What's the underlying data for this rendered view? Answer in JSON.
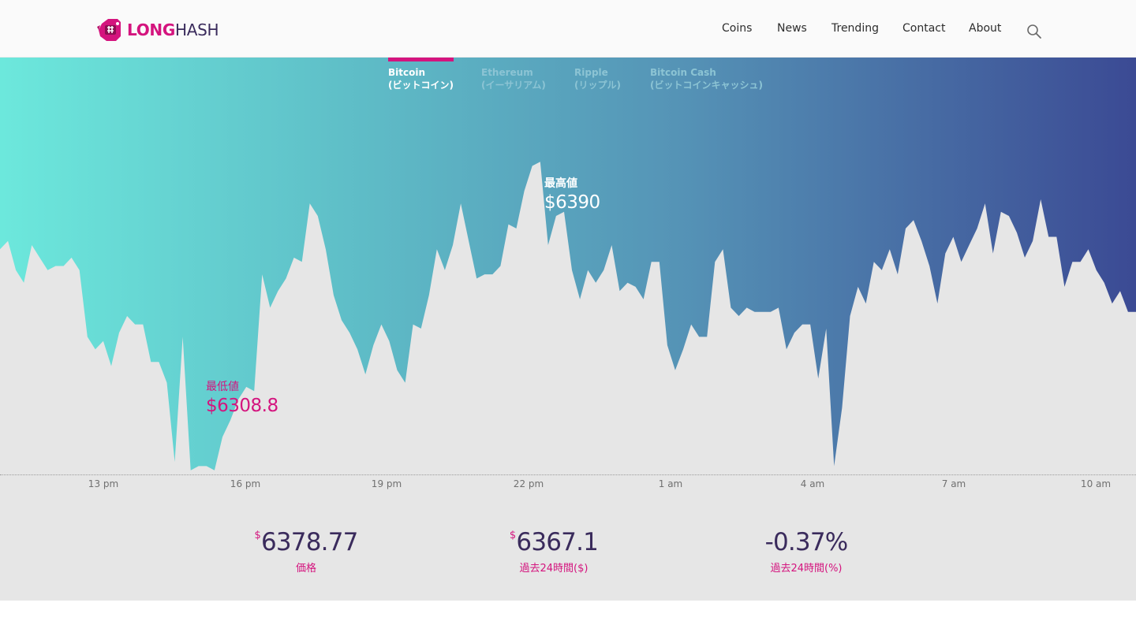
{
  "brand": {
    "name_part1": "LONG",
    "name_part2": "HASH",
    "colors": {
      "primary": "#d4147e",
      "dark": "#3a2b5c"
    }
  },
  "nav": {
    "items": [
      {
        "label": "Coins"
      },
      {
        "label": "News"
      },
      {
        "label": "Trending"
      },
      {
        "label": "Contact"
      },
      {
        "label": "About"
      }
    ],
    "search_icon": "search-icon"
  },
  "tabs": [
    {
      "name": "Bitcoin",
      "sub": "(ビットコイン)",
      "active": true
    },
    {
      "name": "Ethereum",
      "sub": "(イーサリアム)",
      "active": false
    },
    {
      "name": "Ripple",
      "sub": "(リップル)",
      "active": false
    },
    {
      "name": "Bitcoin Cash",
      "sub": "(ビットコインキャッシュ)",
      "active": false
    }
  ],
  "markers": {
    "high": {
      "label": "最高値",
      "value": "$6390"
    },
    "low": {
      "label": "最低値",
      "value": "$6308.8"
    }
  },
  "stats": [
    {
      "currency": "$",
      "value": "6378.77",
      "label": "価格"
    },
    {
      "currency": "$",
      "value": "6367.1",
      "label": "過去24時間($)"
    },
    {
      "currency": "",
      "value": "-0.37%",
      "label": "過去24時間(%)"
    }
  ],
  "chart_data": {
    "type": "area",
    "x_ticks": [
      "13 pm",
      "16 pm",
      "19 pm",
      "22 pm",
      "1 am",
      "4 am",
      "7 am",
      "10 am"
    ],
    "ylim": [
      6300,
      6400
    ],
    "grid": false,
    "legend": "none",
    "gradient_colors": [
      "#6ce8dc",
      "#5fbfc8",
      "#5593b6",
      "#3b4a94"
    ],
    "fill_color": "#e6e6e6",
    "values": [
      6354,
      6356,
      6349,
      6346,
      6355,
      6352,
      6349,
      6350,
      6350,
      6352,
      6349,
      6333,
      6330,
      6332,
      6326,
      6334,
      6338,
      6336,
      6336,
      6327,
      6327,
      6322,
      6303,
      6333,
      6301,
      6302,
      6302,
      6301,
      6309,
      6313,
      6318,
      6321,
      6320,
      6348,
      6340,
      6344,
      6347,
      6352,
      6351,
      6365,
      6362,
      6354,
      6343,
      6337,
      6334,
      6330,
      6324,
      6331,
      6336,
      6332,
      6325,
      6322,
      6336,
      6335,
      6343,
      6354,
      6349,
      6355,
      6365,
      6356,
      6347,
      6348,
      6348,
      6350,
      6360,
      6359,
      6368,
      6374,
      6375,
      6355,
      6362,
      6363,
      6349,
      6342,
      6349,
      6346,
      6349,
      6355,
      6344,
      6346,
      6345,
      6342,
      6351,
      6351,
      6331,
      6325,
      6330,
      6336,
      6333,
      6333,
      6351,
      6354,
      6340,
      6338,
      6340,
      6339,
      6339,
      6339,
      6340,
      6330,
      6334,
      6336,
      6336,
      6323,
      6335,
      6302,
      6316,
      6338,
      6345,
      6341,
      6351,
      6349,
      6354,
      6348,
      6359,
      6361,
      6356,
      6350,
      6341,
      6353,
      6357,
      6351,
      6355,
      6359,
      6365,
      6353,
      6363,
      6362,
      6358,
      6352,
      6356,
      6366,
      6357,
      6357,
      6345,
      6351,
      6351,
      6354,
      6349,
      6346,
      6341,
      6344,
      6339,
      6339
    ],
    "high": 6390,
    "low": 6308.8
  }
}
